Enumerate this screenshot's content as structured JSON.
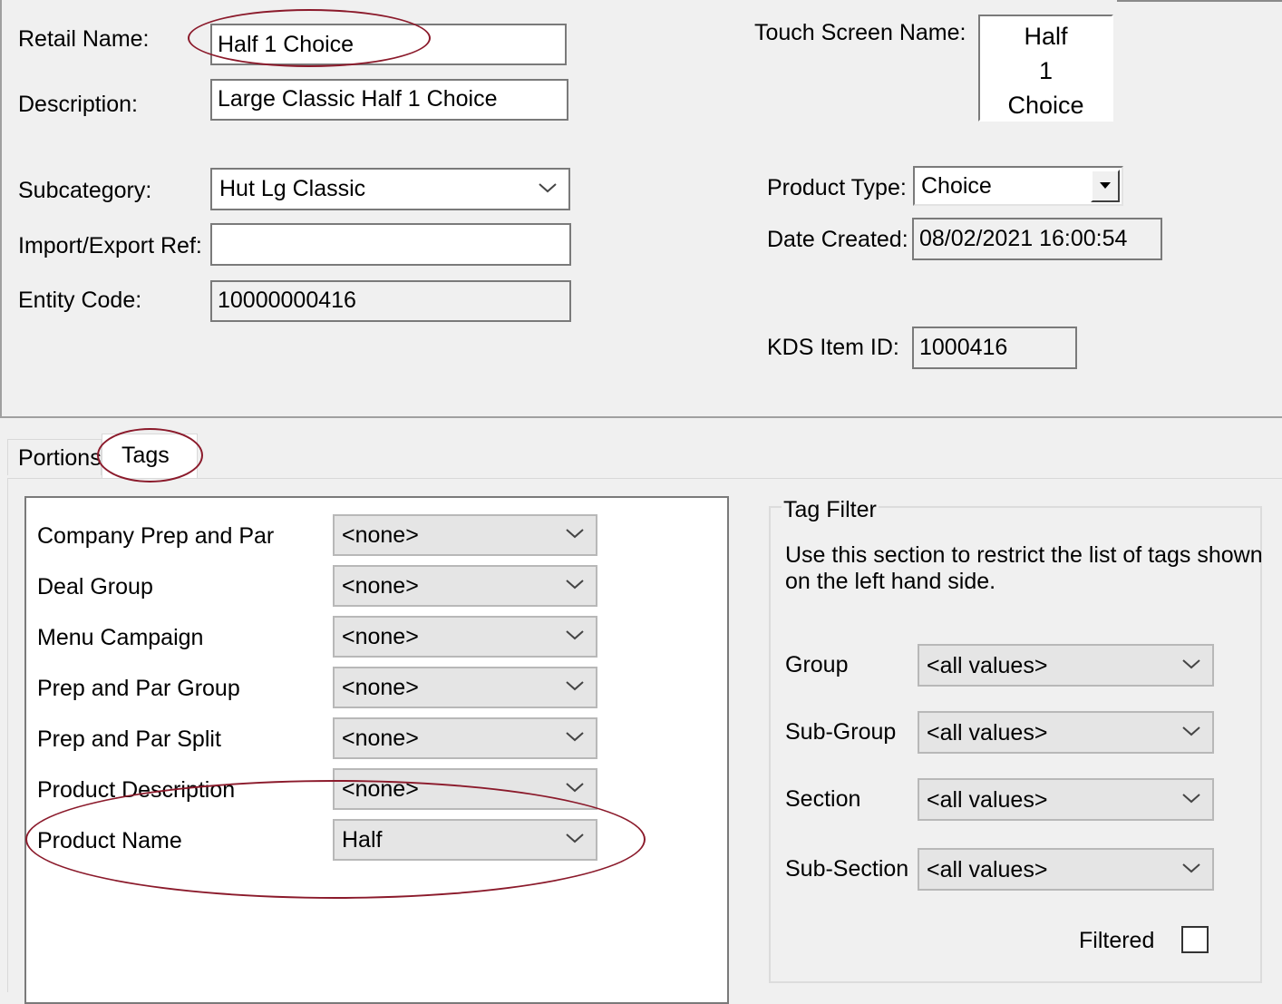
{
  "header": {
    "retail_name_label": "Retail Name:",
    "retail_name_value": "Half 1 Choice",
    "description_label": "Description:",
    "description_value": "Large Classic Half 1 Choice",
    "subcategory_label": "Subcategory:",
    "subcategory_value": "Hut Lg Classic",
    "import_export_label": "Import/Export Ref:",
    "import_export_value": "",
    "entity_code_label": "Entity Code:",
    "entity_code_value": "10000000416",
    "touch_screen_label": "Touch Screen Name:",
    "touch_screen_lines": [
      "Half",
      "1",
      "Choice"
    ],
    "product_type_label": "Product Type:",
    "product_type_value": "Choice",
    "date_created_label": "Date Created:",
    "date_created_value": "08/02/2021 16:00:54",
    "kds_label": "KDS Item ID:",
    "kds_value": "1000416"
  },
  "tabs": [
    {
      "label": "Portions"
    },
    {
      "label": "Tags"
    }
  ],
  "tags": [
    {
      "label": "Company Prep and Par",
      "value": "<none>"
    },
    {
      "label": "Deal Group",
      "value": "<none>"
    },
    {
      "label": "Menu Campaign",
      "value": "<none>"
    },
    {
      "label": "Prep and Par Group",
      "value": "<none>"
    },
    {
      "label": "Prep and Par Split",
      "value": "<none>"
    },
    {
      "label": "Product Description",
      "value": "<none>"
    },
    {
      "label": "Product Name",
      "value": "Half"
    }
  ],
  "tag_filter": {
    "title": "Tag Filter",
    "help_line1": "Use this section to restrict the list of tags shown",
    "help_line2": "on the left hand side.",
    "fields": [
      {
        "label": "Group",
        "value": "<all values>"
      },
      {
        "label": "Sub-Group",
        "value": "<all values>"
      },
      {
        "label": "Section",
        "value": "<all values>"
      },
      {
        "label": "Sub-Section",
        "value": "<all values>"
      }
    ],
    "filtered_label": "Filtered",
    "filtered_checked": false
  },
  "colors": {
    "annotation": "#8b1a2b",
    "window_bg": "#f0f0f0"
  }
}
